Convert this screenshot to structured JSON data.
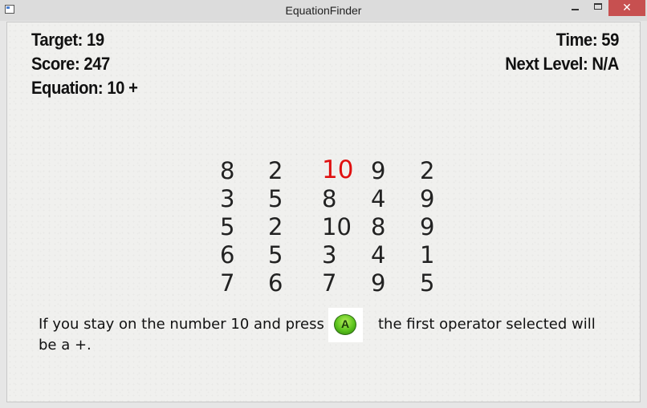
{
  "window": {
    "title": "EquationFinder",
    "min_label": "",
    "max_label": "",
    "close_label": "✕"
  },
  "hud": {
    "target": "Target: 19",
    "score": "Score: 247",
    "equation": "Equation: 10 +",
    "time": "Time:  59",
    "next_level": "Next Level: N/A"
  },
  "grid": {
    "rows": [
      [
        "8",
        "2",
        "10",
        "9",
        "2"
      ],
      [
        "3",
        "5",
        "8",
        "4",
        "9"
      ],
      [
        "5",
        "2",
        "10",
        "8",
        "9"
      ],
      [
        "6",
        "5",
        "3",
        "4",
        "1"
      ],
      [
        "7",
        "6",
        "7",
        "9",
        "5"
      ]
    ],
    "highlight": {
      "row": 0,
      "col": 2
    },
    "highlight_color": "#e01010"
  },
  "hint": {
    "part1": "If you stay on the number 10 and press",
    "button_label": "A",
    "part2": "the first operator selected will",
    "part3": "be a +."
  }
}
